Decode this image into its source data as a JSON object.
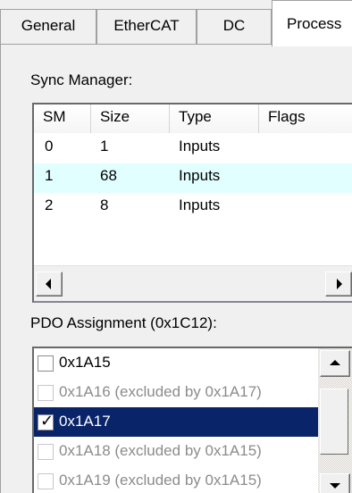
{
  "tabs": [
    {
      "label": "General"
    },
    {
      "label": "EtherCAT"
    },
    {
      "label": "DC"
    },
    {
      "label": "Process"
    }
  ],
  "sync_manager": {
    "label": "Sync Manager:",
    "columns": [
      "SM",
      "Size",
      "Type",
      "Flags"
    ],
    "rows": [
      {
        "sm": "0",
        "size": "1",
        "type": "Inputs",
        "flags": ""
      },
      {
        "sm": "1",
        "size": "68",
        "type": "Inputs",
        "flags": ""
      },
      {
        "sm": "2",
        "size": "8",
        "type": "Inputs",
        "flags": ""
      }
    ]
  },
  "pdo_assignment": {
    "label": "PDO Assignment (0x1C12):",
    "items": [
      {
        "text": "0x1A15",
        "checked": false,
        "disabled": false,
        "selected": false
      },
      {
        "text": "0x1A16 (excluded by 0x1A17)",
        "checked": false,
        "disabled": true,
        "selected": false
      },
      {
        "text": "0x1A17",
        "checked": true,
        "disabled": false,
        "selected": true
      },
      {
        "text": "0x1A18 (excluded by 0x1A15)",
        "checked": false,
        "disabled": true,
        "selected": false
      },
      {
        "text": "0x1A19 (excluded by 0x1A15)",
        "checked": false,
        "disabled": true,
        "selected": false
      }
    ]
  }
}
